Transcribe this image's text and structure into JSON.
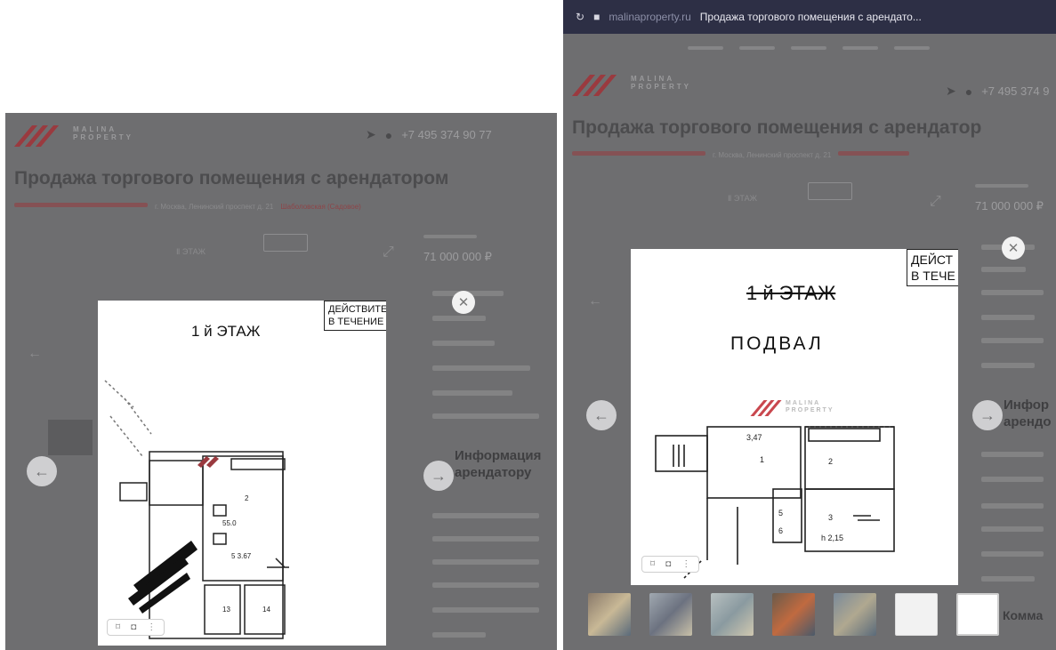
{
  "left": {
    "logo_text": "MALINA PROPERTY",
    "phone": "+7 495 374 90 77",
    "page_title": "Продажа торгового помещения с арендатором",
    "breadcrumb_address": "г. Москва, Ленинский проспект д. 21",
    "breadcrumb_metro": "Шаболовская (Садовое)",
    "floor_tab": "Ⅱ ЭТАЖ",
    "price": "71 000 000 ₽",
    "side_heading": "Информация\nарендатору",
    "plan": {
      "floor_label": "1 й ЭТАЖ",
      "stamp": "ДЕЙСТВИТЕ\nВ ТЕЧЕНИЕ"
    }
  },
  "right": {
    "browser": {
      "url": "malinaproperty.ru",
      "tab_title": "Продажа торгового помещения с арендато..."
    },
    "logo_text": "MALINA PROPERTY",
    "phone": "+7 495 374 9",
    "page_title": "Продажа торгового помещения с арендатор",
    "breadcrumb_address": "г. Москва, Ленинский проспект д. 21",
    "floor_tab": "Ⅱ ЭТАЖ",
    "price": "71 000 000 ₽",
    "side_heading": "Инфор\nарендо",
    "side_heading_2": "Комма",
    "plan": {
      "floor_label": "1 й ЭТАЖ",
      "basement_label": "ПОДВАЛ",
      "stamp": "ДЕЙСТ\nВ ТЕЧЕ",
      "watermark": "MALINA PROPERTY"
    }
  },
  "colors": {
    "brand": "#9a3a3f",
    "overlay": "#6e6e70"
  }
}
